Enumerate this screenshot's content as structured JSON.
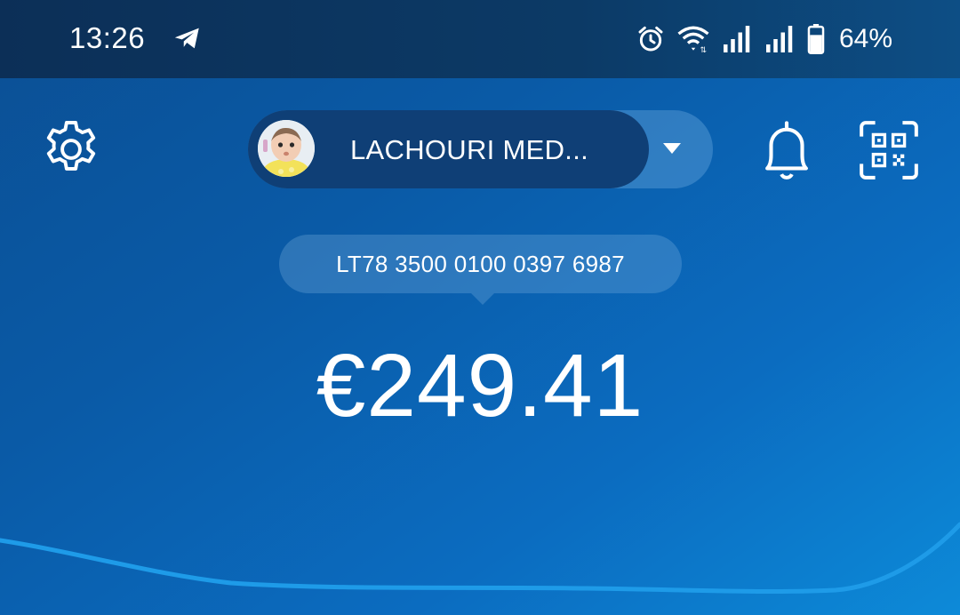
{
  "status_bar": {
    "time": "13:26",
    "battery_percent": "64%",
    "icons": [
      "telegram-icon",
      "alarm-icon",
      "wifi-icon",
      "signal-icon",
      "signal-icon",
      "battery-icon"
    ]
  },
  "header": {
    "account_name": "LACHOURI MED...",
    "icons": [
      "gear-icon",
      "avatar",
      "caret-down-icon",
      "bell-icon",
      "qr-scan-icon"
    ]
  },
  "account": {
    "iban": "LT78 3500 0100 0397 6987",
    "balance": "€249.41"
  },
  "colors": {
    "status_bar": "#0c3a66",
    "background": "#0a5aa6",
    "pill_dark": "#0f3f76",
    "chart_line": "#1e9be8"
  }
}
